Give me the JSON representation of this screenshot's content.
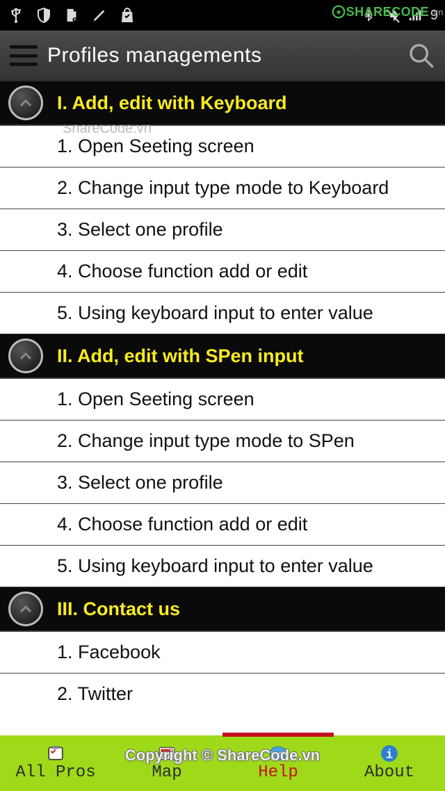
{
  "status": {
    "signal_text": "9"
  },
  "watermarks": {
    "sharecode_logo": "SHARECODE",
    "sharecode_suffix": ".vn",
    "top_text": "ShareCode.vn",
    "bottom_text": "Copyright © ShareCode.vn"
  },
  "header": {
    "title": "Profiles managements"
  },
  "sections": [
    {
      "title": "I. Add, edit with Keyboard",
      "items": [
        "1. Open Seeting screen",
        "2. Change input type mode to Keyboard",
        "3. Select one profile",
        "4. Choose function add or edit",
        "5. Using keyboard input to enter value"
      ]
    },
    {
      "title": "II. Add, edit with SPen input",
      "items": [
        "1. Open Seeting screen",
        "2. Change input type mode to SPen",
        "3. Select one profile",
        "4. Choose function add or edit",
        "5. Using keyboard input to enter value"
      ]
    },
    {
      "title": "III. Contact us",
      "items": [
        "1. Facebook",
        "2. Twitter"
      ]
    }
  ],
  "nav": {
    "items": [
      {
        "label": "All Pros"
      },
      {
        "label": "Map"
      },
      {
        "label": "Help"
      },
      {
        "label": "About"
      }
    ],
    "active_index": 2
  }
}
